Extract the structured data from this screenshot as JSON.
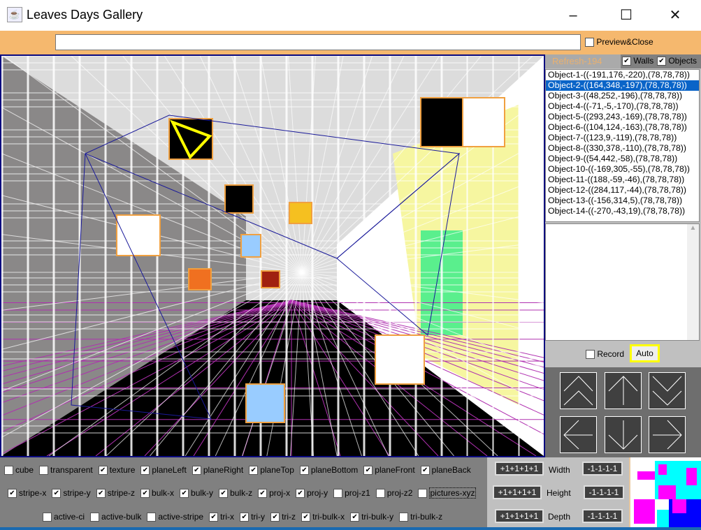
{
  "window": {
    "title": "Leaves Days Gallery",
    "minimize": "–",
    "maximize": "☐",
    "close": "✕"
  },
  "topbar": {
    "search_value": "",
    "preview_close": {
      "label": "Preview&Close",
      "checked": false
    }
  },
  "panel": {
    "refresh_label": "Refresh-194",
    "walls": {
      "label": "Walls",
      "checked": true
    },
    "objects": {
      "label": "Objects",
      "checked": true
    },
    "objects_list": [
      "Object-1-((-191,176,-220),(78,78,78))",
      "Object-2-((164,348,-197),(78,78,78))",
      "Object-3-((48,252,-196),(78,78,78))",
      "Object-4-((-71,-5,-170),(78,78,78))",
      "Object-5-((293,243,-169),(78,78,78))",
      "Object-6-((104,124,-163),(78,78,78))",
      "Object-7-((123,9,-119),(78,78,78))",
      "Object-8-((330,378,-110),(78,78,78))",
      "Object-9-((54,442,-58),(78,78,78))",
      "Object-10-((-169,305,-55),(78,78,78))",
      "Object-11-((188,-59,-46),(78,78,78))",
      "Object-12-((284,117,-44),(78,78,78))",
      "Object-13-((-156,314,5),(78,78,78))",
      "Object-14-((-270,-43,19),(78,78,78))"
    ],
    "selected_index": 1,
    "record": {
      "label": "Record",
      "checked": false
    },
    "auto_label": "Auto",
    "nav_buttons": [
      "double-up",
      "up",
      "double-down",
      "left",
      "down",
      "right"
    ]
  },
  "options": {
    "row1": [
      {
        "label": "cube",
        "checked": false
      },
      {
        "label": "transparent",
        "checked": false
      },
      {
        "label": "texture",
        "checked": true
      },
      {
        "label": "planeLeft",
        "checked": true
      },
      {
        "label": "planeRight",
        "checked": true
      },
      {
        "label": "planeTop",
        "checked": true
      },
      {
        "label": "planeBottom",
        "checked": true
      },
      {
        "label": "planeFront",
        "checked": true
      },
      {
        "label": "planeBack",
        "checked": true
      }
    ],
    "row2": [
      {
        "label": "stripe-x",
        "checked": true
      },
      {
        "label": "stripe-y",
        "checked": true
      },
      {
        "label": "stripe-z",
        "checked": true
      },
      {
        "label": "bulk-x",
        "checked": true
      },
      {
        "label": "bulk-y",
        "checked": true
      },
      {
        "label": "bulk-z",
        "checked": true
      },
      {
        "label": "proj-x",
        "checked": true
      },
      {
        "label": "proj-y",
        "checked": true
      },
      {
        "label": "proj-z1",
        "checked": false
      },
      {
        "label": "proj-z2",
        "checked": false
      },
      {
        "label": "pictures-xyz",
        "checked": false
      }
    ],
    "row3": [
      {
        "label": "active-ci",
        "checked": false
      },
      {
        "label": "active-bulk",
        "checked": false
      },
      {
        "label": "active-stripe",
        "checked": false
      },
      {
        "label": "tri-x",
        "checked": true
      },
      {
        "label": "tri-y",
        "checked": true
      },
      {
        "label": "tri-z",
        "checked": true
      },
      {
        "label": "tri-bulk-x",
        "checked": true
      },
      {
        "label": "tri-bulk-y",
        "checked": true
      },
      {
        "label": "tri-bulk-z",
        "checked": false
      }
    ]
  },
  "dimensions": [
    {
      "label": "Width",
      "inc": "+1+1+1+1",
      "dec": "-1-1-1-1"
    },
    {
      "label": "Height",
      "inc": "+1+1+1+1",
      "dec": "-1-1-1-1"
    },
    {
      "label": "Depth",
      "inc": "+1+1+1+1",
      "dec": "-1-1-1-1"
    }
  ],
  "colors": {
    "topbar": "#f5b86e",
    "selection": "#0a64c8",
    "floor_grid": "#c040c0",
    "wire": "#1a1a9a",
    "auto_border": "#ffff00"
  }
}
